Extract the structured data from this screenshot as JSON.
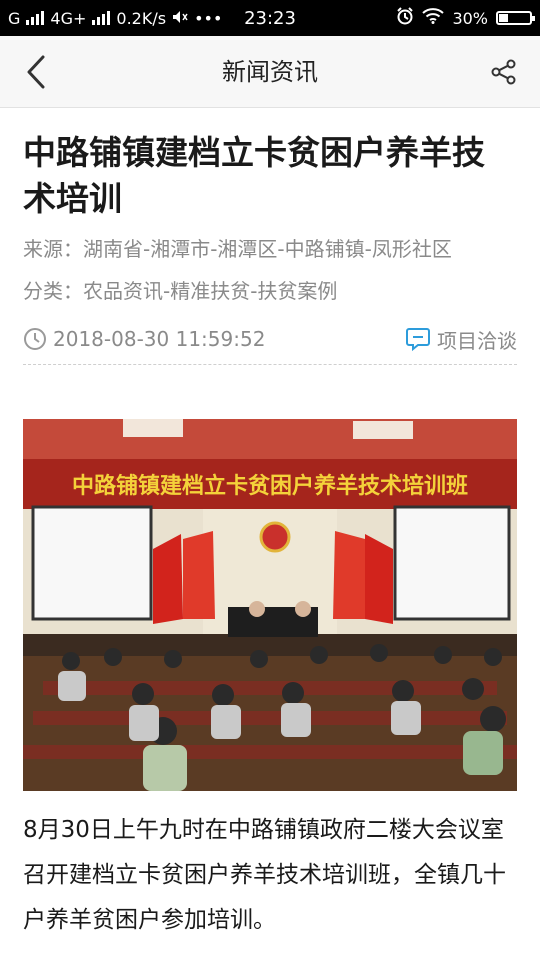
{
  "status_bar": {
    "carrier_left": "G",
    "network": "4G+",
    "speed": "0.2K/s",
    "more": "•••",
    "time": "23:23",
    "battery_text": "30%",
    "battery_level": 0.3
  },
  "nav": {
    "title": "新闻资讯"
  },
  "article": {
    "title": "中路铺镇建档立卡贫困户养羊技术培训",
    "source": "来源：湖南省-湘潭市-湘潭区-中路铺镇-凤形社区",
    "category": "分类：农品资讯-精准扶贫-扶贫案例",
    "date": "2018-08-30 11:59:52",
    "project_label": "项目洽谈",
    "image_banner": "中路铺镇建档立卡贫困户养羊技术培训班",
    "body": "8月30日上午九时在中路铺镇政府二楼大会议室召开建档立卡贫困户养羊技术培训班，全镇几十户养羊贫困户参加培训。"
  }
}
